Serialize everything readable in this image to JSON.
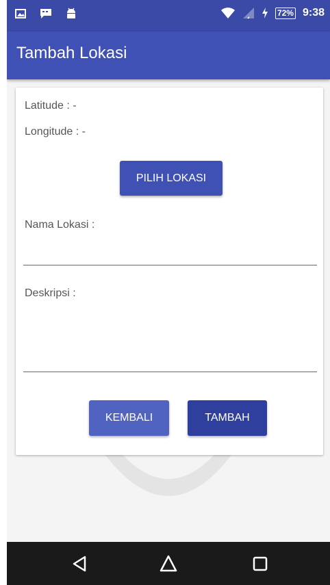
{
  "status_bar": {
    "battery": "72%",
    "time": "9:38",
    "icons": [
      "image-icon",
      "chat-icon",
      "android-icon",
      "wifi-icon",
      "signal-icon",
      "charging-icon"
    ]
  },
  "app_bar": {
    "title": "Tambah Lokasi"
  },
  "form": {
    "latitude_label": "Latitude : -",
    "longitude_label": "Longitude : -",
    "pilih_lokasi_button": "PILIH LOKASI",
    "nama_lokasi_label": "Nama Lokasi :",
    "nama_lokasi_value": "",
    "deskripsi_label": "Deskripsi :",
    "deskripsi_value": "",
    "kembali_button": "KEMBALI",
    "tambah_button": "TAMBAH"
  },
  "nav_bar": {
    "icons": [
      "back-icon",
      "home-icon",
      "recents-icon"
    ]
  },
  "colors": {
    "status_bar": "#3a4aa6",
    "app_bar": "#3f51b5",
    "primary_button": "#3f51b5",
    "kembali_button": "#5063c0",
    "tambah_button": "#2f3f9e",
    "nav_bar": "#1a1a1a",
    "background": "#f4f4f4"
  }
}
